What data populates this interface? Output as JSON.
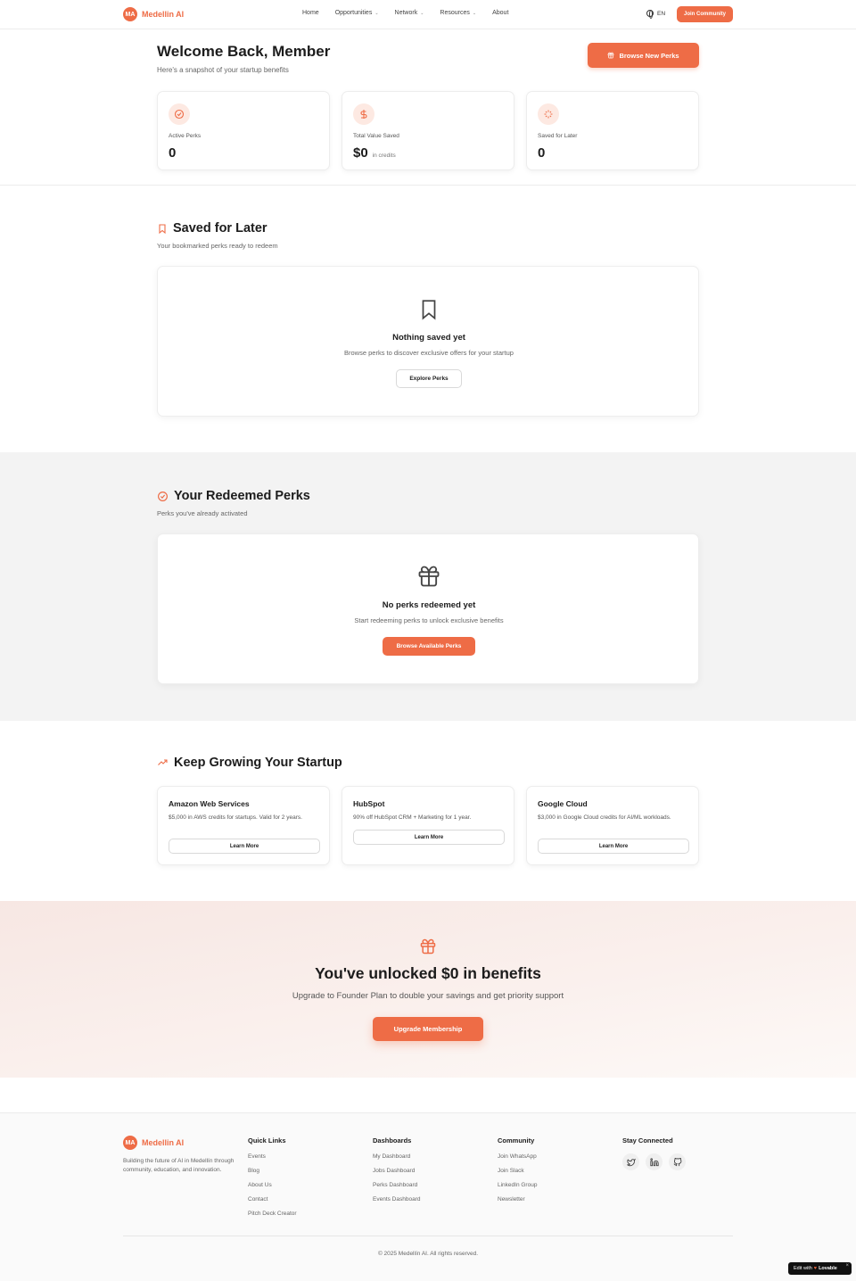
{
  "brand": {
    "initials": "MA",
    "name": "Medellin AI",
    "accent": "#ee6c46"
  },
  "nav": {
    "links": [
      {
        "label": "Home",
        "dropdown": false
      },
      {
        "label": "Opportunities",
        "dropdown": true
      },
      {
        "label": "Network",
        "dropdown": true
      },
      {
        "label": "Resources",
        "dropdown": true
      },
      {
        "label": "About",
        "dropdown": false
      }
    ],
    "language": "EN",
    "join_label": "Join Community"
  },
  "header": {
    "title": "Welcome Back, Member",
    "subtitle": "Here's a snapshot of your startup benefits",
    "browse_label": "Browse New Perks"
  },
  "stats": [
    {
      "icon": "check-circle-icon",
      "label": "Active Perks",
      "value": "0",
      "unit": ""
    },
    {
      "icon": "dollar-icon",
      "label": "Total Value Saved",
      "value": "$0",
      "unit": "in credits"
    },
    {
      "icon": "sparkles-icon",
      "label": "Saved for Later",
      "value": "0",
      "unit": ""
    }
  ],
  "saved": {
    "title": "Saved for Later",
    "subtitle": "Your bookmarked perks ready to redeem",
    "empty_title": "Nothing saved yet",
    "empty_sub": "Browse perks to discover exclusive offers for your startup",
    "button": "Explore Perks"
  },
  "redeemed": {
    "title": "Your Redeemed Perks",
    "subtitle": "Perks you've already activated",
    "empty_title": "No perks redeemed yet",
    "empty_sub": "Start redeeming perks to unlock exclusive benefits",
    "button": "Browse Available Perks"
  },
  "growing": {
    "title": "Keep Growing Your Startup",
    "perks": [
      {
        "name": "Amazon Web Services",
        "desc": "$5,000 in AWS credits for startups. Valid for 2 years.",
        "button": "Learn More"
      },
      {
        "name": "HubSpot",
        "desc": "90% off HubSpot CRM + Marketing for 1 year.",
        "button": "Learn More"
      },
      {
        "name": "Google Cloud",
        "desc": "$3,000 in Google Cloud credits for AI/ML workloads.",
        "button": "Learn More"
      }
    ]
  },
  "cta": {
    "title": "You've unlocked $0 in benefits",
    "subtitle": "Upgrade to Founder Plan to double your savings and get priority support",
    "button": "Upgrade Membership"
  },
  "footer": {
    "description": "Building the future of AI in Medellín through community, education, and innovation.",
    "columns": [
      {
        "title": "Quick Links",
        "links": [
          "Events",
          "Blog",
          "About Us",
          "Contact",
          "Pitch Deck Creator"
        ]
      },
      {
        "title": "Dashboards",
        "links": [
          "My Dashboard",
          "Jobs Dashboard",
          "Perks Dashboard",
          "Events Dashboard"
        ]
      },
      {
        "title": "Community",
        "links": [
          "Join WhatsApp",
          "Join Slack",
          "LinkedIn Group",
          "Newsletter"
        ]
      }
    ],
    "social_title": "Stay Connected",
    "social_icons": [
      "twitter-icon",
      "linkedin-icon",
      "github-icon"
    ],
    "copyright": "© 2025 Medellín AI. All rights reserved."
  },
  "badge": {
    "prefix": "Edit with",
    "name": "Lovable"
  }
}
